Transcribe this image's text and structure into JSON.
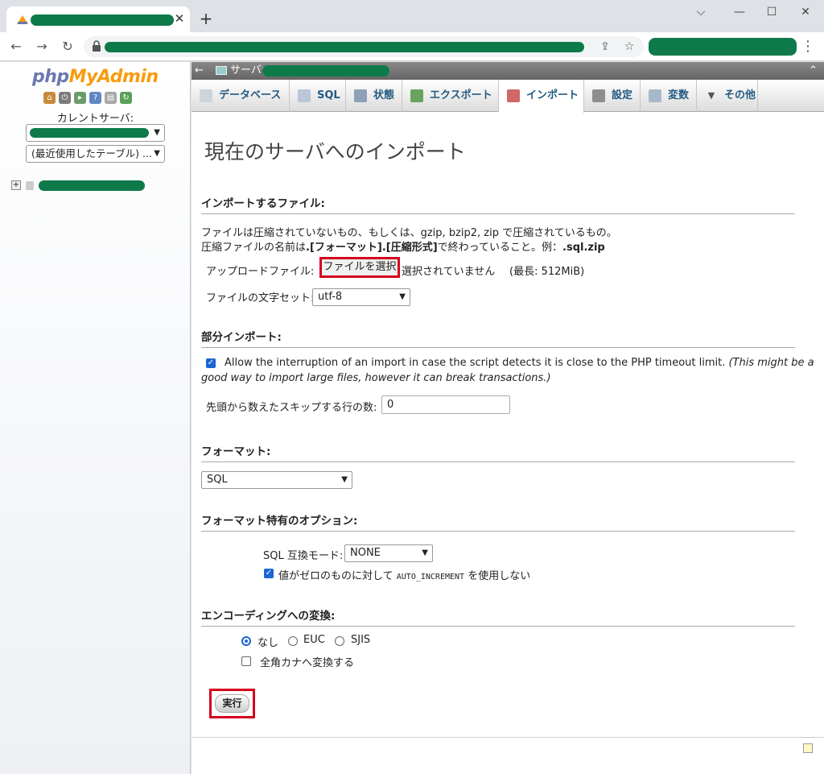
{
  "browser": {
    "close_glyph": "✕",
    "newtab_glyph": "+",
    "controls": {
      "min": "⌵",
      "restore": "—",
      "max": "☐",
      "close": "✕"
    },
    "nav": {
      "back": "←",
      "forward": "→",
      "reload": "↻"
    },
    "share_glyph": "⇪",
    "star_glyph": "☆",
    "kebab_glyph": "⋮"
  },
  "nav": {
    "logo_php": "php",
    "logo_my": "My",
    "logo_admin": "Admin",
    "current_server_label": "カレントサーバ:",
    "recent_tables": "(最近使用したテーブル) ...",
    "expander": "+"
  },
  "server_bar": {
    "back_glyph": "←",
    "label": "サーバ:",
    "collapse_glyph": "⌃"
  },
  "tabs": [
    {
      "label": "データベース",
      "color": "#cfd4d9"
    },
    {
      "label": "SQL",
      "color": "#b9c7d6"
    },
    {
      "label": "状態",
      "color": "#8ea0b8"
    },
    {
      "label": "エクスポート",
      "color": "#6aa35e"
    },
    {
      "label": "インポート",
      "color": "#d06868"
    },
    {
      "label": "設定",
      "color": "#8e8e8e"
    },
    {
      "label": "変数",
      "color": "#a9b9cc"
    },
    {
      "label": "その他",
      "color": "#555555"
    }
  ],
  "page": {
    "title": "現在のサーバへのインポート",
    "file_section": {
      "heading": "インポートするファイル:",
      "desc1": "ファイルは圧縮されていないもの、もしくは、gzip, bzip2, zip で圧縮されているもの。",
      "desc2_a": "圧縮ファイルの名前は",
      "desc2_b": ".[フォーマット].[圧縮形式]",
      "desc2_c": "で終わっていること。例：",
      "desc2_d": ".sql.zip",
      "upload_label": "アップロードファイル:",
      "upload_button": "ファイルを選択",
      "no_file": "選択されていません",
      "max": "(最長: 512MiB)",
      "charset_label": "ファイルの文字セット:",
      "charset_value": "utf-8"
    },
    "partial_section": {
      "heading": "部分インポート:",
      "allow_text": "Allow the interruption of an import in case the script detects it is close to the PHP timeout limit.",
      "allow_note_1": "(This might be a",
      "allow_note_2": "good way to import large files, however it can break transactions.)",
      "skip_label": "先頭から数えたスキップする行の数:",
      "skip_value": "0"
    },
    "format_section": {
      "heading": "フォーマット:",
      "value": "SQL"
    },
    "options_section": {
      "heading": "フォーマット特有のオプション:",
      "compat_label": "SQL 互換モード:",
      "compat_value": "NONE",
      "auto_inc_a": "値がゼロのものに対して",
      "auto_inc_b": "AUTO_INCREMENT",
      "auto_inc_c": "を使用しない"
    },
    "encoding_section": {
      "heading": "エンコーディングへの変換:",
      "radio_none": "なし",
      "radio_euc": "EUC",
      "radio_sjis": "SJIS",
      "kana_label": "全角カナへ変換する"
    },
    "go_button": "実行"
  }
}
